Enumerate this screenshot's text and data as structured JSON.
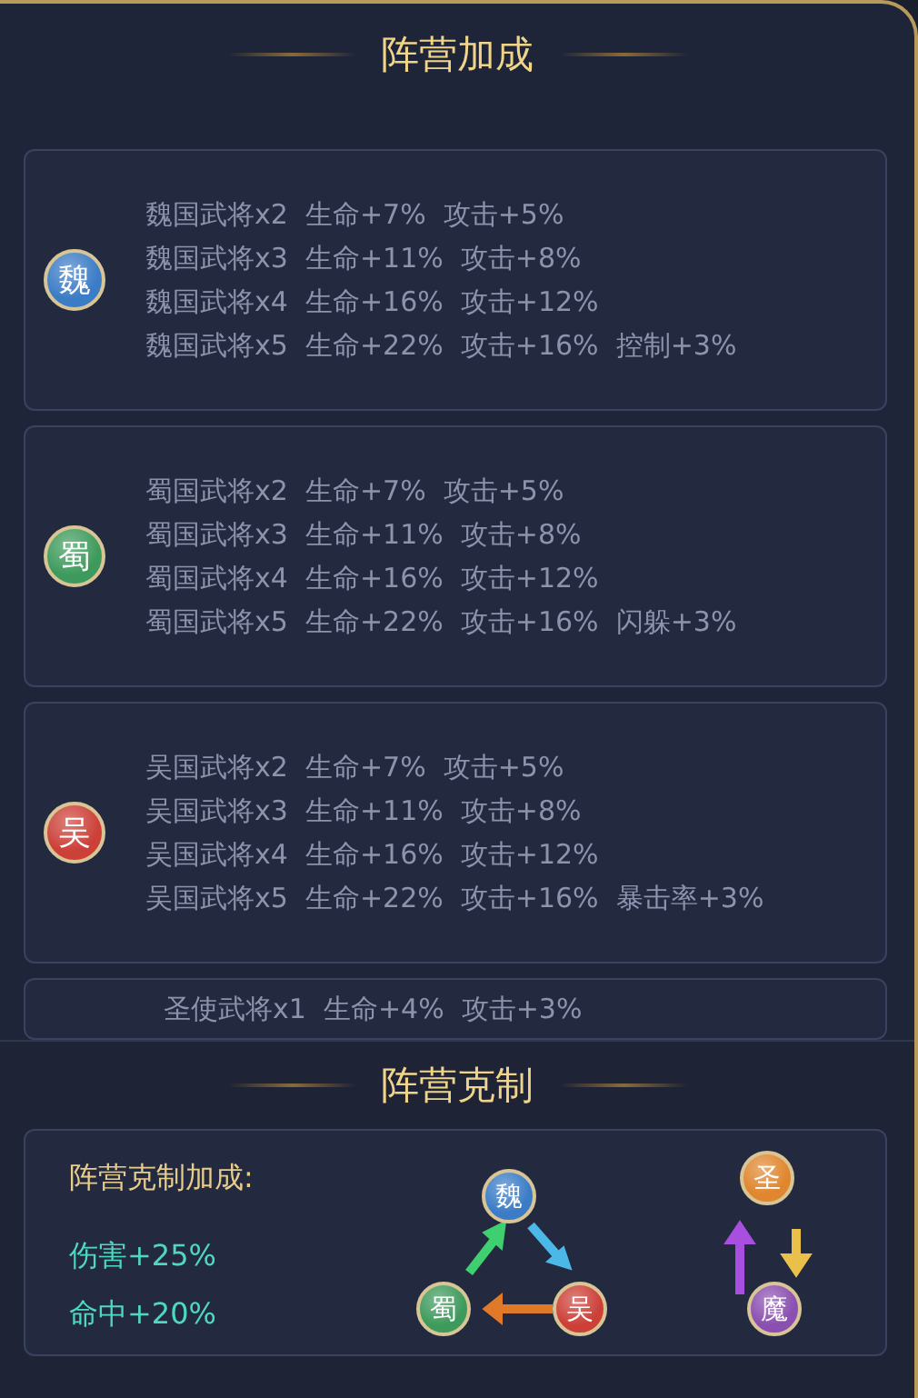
{
  "title": "阵营加成",
  "factions": [
    {
      "emblem": "魏",
      "color": "#3b7cc6",
      "bonuses": [
        "魏国武将x2  生命+7%  攻击+5%",
        "魏国武将x3  生命+11%  攻击+8%",
        "魏国武将x4  生命+16%  攻击+12%",
        "魏国武将x5  生命+22%  攻击+16%  控制+3%"
      ]
    },
    {
      "emblem": "蜀",
      "color": "#3e9a5c",
      "bonuses": [
        "蜀国武将x2  生命+7%  攻击+5%",
        "蜀国武将x3  生命+11%  攻击+8%",
        "蜀国武将x4  生命+16%  攻击+12%",
        "蜀国武将x5  生命+22%  攻击+16%  闪躲+3%"
      ]
    },
    {
      "emblem": "吴",
      "color": "#cc4038",
      "bonuses": [
        "吴国武将x2  生命+7%  攻击+5%",
        "吴国武将x3  生命+11%  攻击+8%",
        "吴国武将x4  生命+16%  攻击+12%",
        "吴国武将x5  生命+22%  攻击+16%  暴击率+3%"
      ]
    },
    {
      "bonuses": [
        "圣使武将x1  生命+4%  攻击+3%"
      ]
    }
  ],
  "restraint": {
    "title": "阵营克制",
    "label": "阵营克制加成:",
    "effects": [
      "伤害+25%",
      "命中+20%"
    ],
    "diagram": [
      {
        "emblem": "魏",
        "color": "#3b7cc6"
      },
      {
        "emblem": "蜀",
        "color": "#3e9a5c"
      },
      {
        "emblem": "吴",
        "color": "#cc4038"
      },
      {
        "emblem": "圣",
        "color": "#e0862e"
      },
      {
        "emblem": "魔",
        "color": "#8a4fb0"
      }
    ]
  }
}
